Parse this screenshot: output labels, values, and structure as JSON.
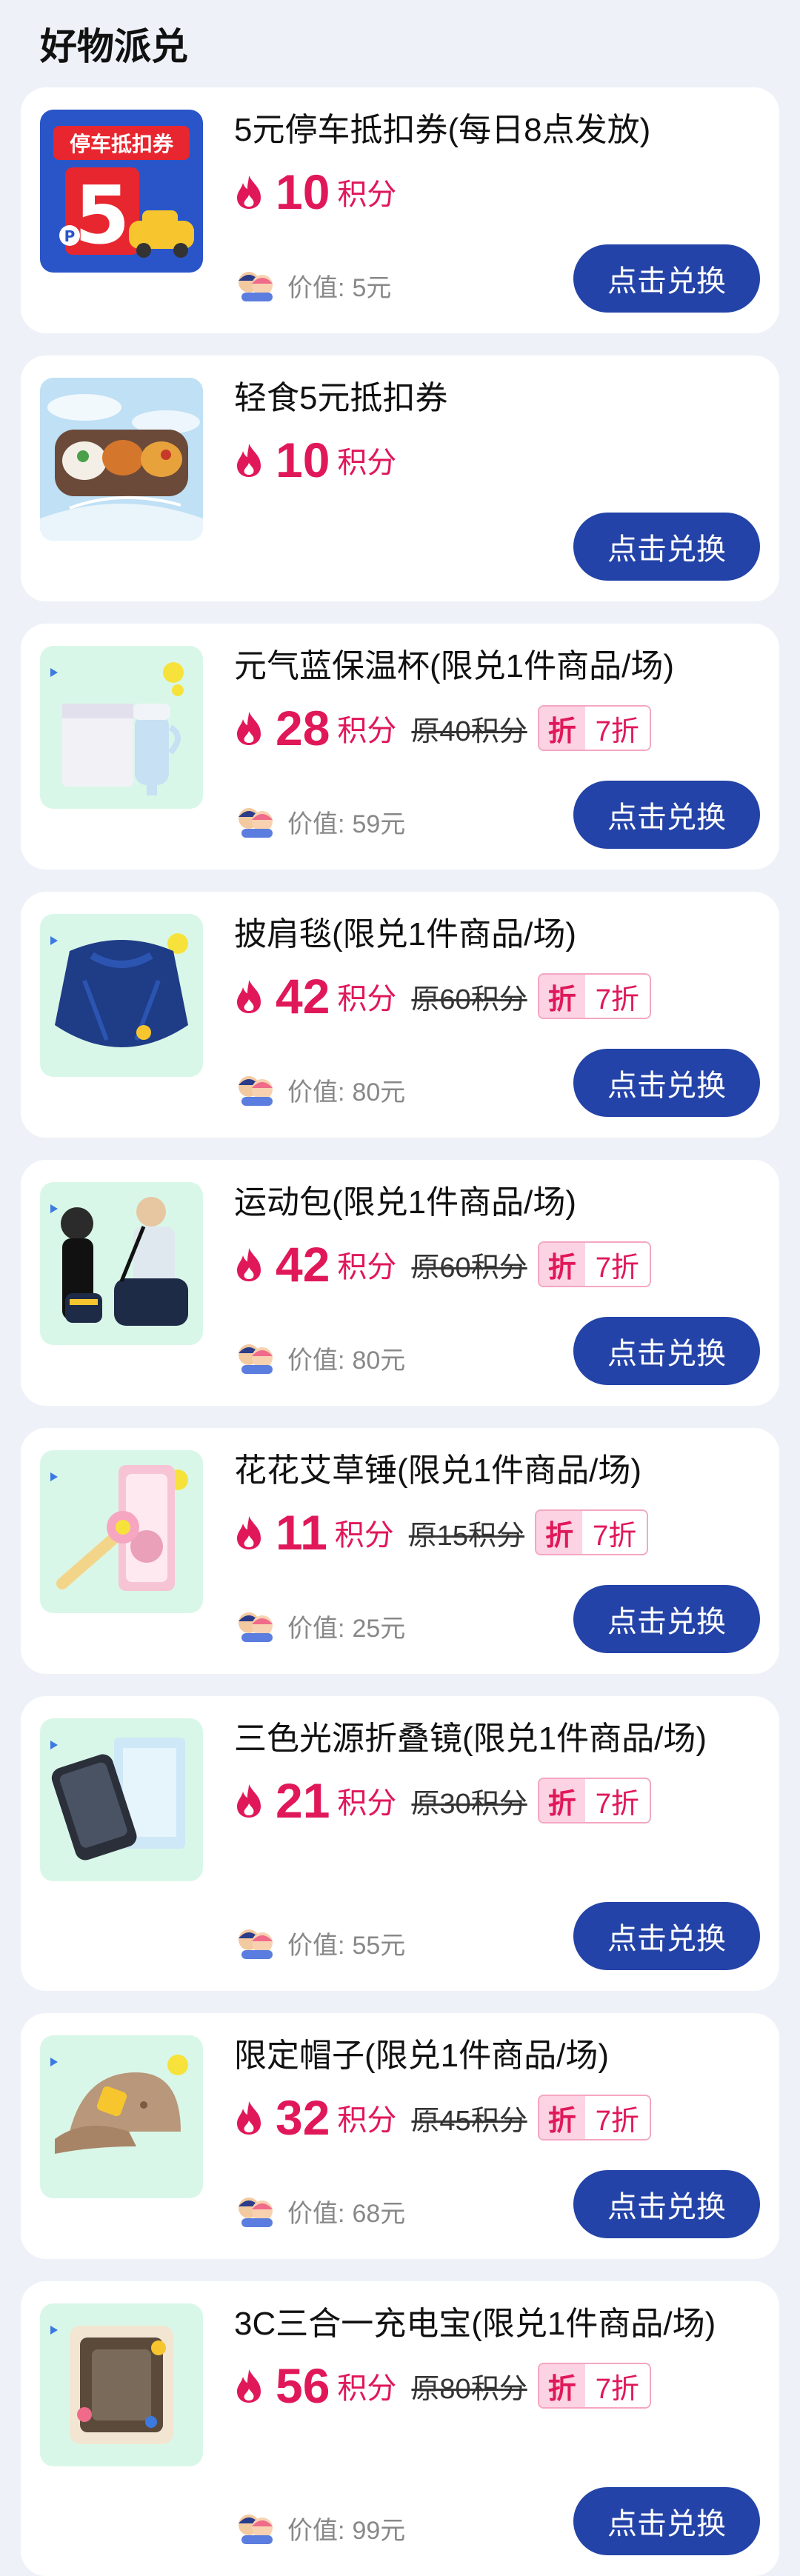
{
  "section_title": "好物派兑",
  "unit": "积分",
  "discount_label": "折",
  "value_prefix": "价值:",
  "button_label": "点击兑换",
  "colors": {
    "accent": "#e0185a",
    "button": "#2443a8",
    "card": "#ffffff",
    "background": "#eef2f8"
  },
  "items": [
    {
      "title": "5元停车抵扣券(每日8点发放)",
      "points": "10",
      "original": "",
      "discount": "",
      "value": "5元",
      "thumb_icon": "parking-coupon-icon",
      "thumb_text": "停车抵扣券",
      "thumb_num": "5"
    },
    {
      "title": "轻食5元抵扣券",
      "points": "10",
      "original": "",
      "discount": "",
      "value": "",
      "thumb_icon": "food-box-icon"
    },
    {
      "title": "元气蓝保温杯(限兑1件商品/场)",
      "points": "28",
      "original": "原40积分",
      "discount": "7折",
      "value": "59元",
      "thumb_icon": "thermos-cup-icon"
    },
    {
      "title": "披肩毯(限兑1件商品/场)",
      "points": "42",
      "original": "原60积分",
      "discount": "7折",
      "value": "80元",
      "thumb_icon": "blanket-icon"
    },
    {
      "title": "运动包(限兑1件商品/场)",
      "points": "42",
      "original": "原60积分",
      "discount": "7折",
      "value": "80元",
      "thumb_icon": "sports-bag-icon"
    },
    {
      "title": "花花艾草锤(限兑1件商品/场)",
      "points": "11",
      "original": "原15积分",
      "discount": "7折",
      "value": "25元",
      "thumb_icon": "massage-hammer-icon"
    },
    {
      "title": "三色光源折叠镜(限兑1件商品/场)",
      "points": "21",
      "original": "原30积分",
      "discount": "7折",
      "value": "55元",
      "thumb_icon": "folding-mirror-icon"
    },
    {
      "title": "限定帽子(限兑1件商品/场)",
      "points": "32",
      "original": "原45积分",
      "discount": "7折",
      "value": "68元",
      "thumb_icon": "cap-icon"
    },
    {
      "title": "3C三合一充电宝(限兑1件商品/场)",
      "points": "56",
      "original": "原80积分",
      "discount": "7折",
      "value": "99元",
      "thumb_icon": "power-bank-icon"
    }
  ]
}
